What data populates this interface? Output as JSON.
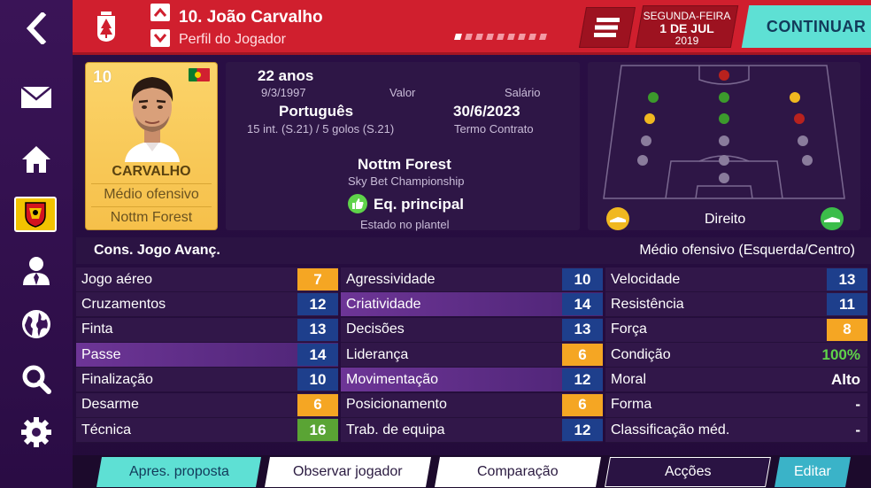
{
  "header": {
    "title": "10. João Carvalho",
    "subtitle": "Perfil do Jogador",
    "date_day": "SEGUNDA-FEIRA",
    "date_main": "1 DE JUL",
    "date_year": "2019",
    "continue_label": "CONTINUAR",
    "page_dots": 9,
    "active_dot": 0
  },
  "sidebar": {
    "items": [
      "back-arrow-icon",
      "mail-icon",
      "home-icon",
      "club-badge",
      "person-icon",
      "globe-icon",
      "search-icon",
      "settings-icon"
    ]
  },
  "player_card": {
    "number": "10",
    "name": "CARVALHO",
    "position": "Médio ofensivo",
    "club": "Nottm Forest",
    "nationality_flag": "portugal-flag"
  },
  "info": {
    "age": "22 anos",
    "dob": "9/3/1997",
    "value_label": "Valor",
    "salary_label": "Salário",
    "nationality": "Português",
    "caps": "15 int. (S.21) / 5 golos (S.21)",
    "contract_end": "30/6/2023",
    "contract_label": "Termo Contrato",
    "club": "Nottm Forest",
    "league": "Sky Bet Championship",
    "squad_status": "Eq. principal",
    "squad_status_label": "Estado no plantel"
  },
  "pitch": {
    "foot_label": "Direito"
  },
  "attributes": {
    "role": "Cons. Jogo Avanç.",
    "position_detail": "Médio ofensivo (Esquerda/Centro)",
    "col1": [
      {
        "label": "Jogo aéreo",
        "value": "7",
        "style": "orange"
      },
      {
        "label": "Cruzamentos",
        "value": "12",
        "style": "blue"
      },
      {
        "label": "Finta",
        "value": "13",
        "style": "blue"
      },
      {
        "label": "Passe",
        "value": "14",
        "style": "blue",
        "highlight": true
      },
      {
        "label": "Finalização",
        "value": "10",
        "style": "blue"
      },
      {
        "label": "Desarme",
        "value": "6",
        "style": "orange"
      },
      {
        "label": "Técnica",
        "value": "16",
        "style": "green"
      }
    ],
    "col2": [
      {
        "label": "Agressividade",
        "value": "10",
        "style": "blue"
      },
      {
        "label": "Criatividade",
        "value": "14",
        "style": "blue",
        "highlight": true
      },
      {
        "label": "Decisões",
        "value": "13",
        "style": "blue"
      },
      {
        "label": "Liderança",
        "value": "6",
        "style": "orange"
      },
      {
        "label": "Movimentação",
        "value": "12",
        "style": "blue",
        "highlight": true
      },
      {
        "label": "Posicionamento",
        "value": "6",
        "style": "orange"
      },
      {
        "label": "Trab. de equipa",
        "value": "12",
        "style": "blue"
      }
    ],
    "col3": [
      {
        "label": "Velocidade",
        "value": "13",
        "style": "blue"
      },
      {
        "label": "Resistência",
        "value": "11",
        "style": "blue"
      },
      {
        "label": "Força",
        "value": "8",
        "style": "orange"
      },
      {
        "label": "Condição",
        "value": "100%",
        "style": "good"
      },
      {
        "label": "Moral",
        "value": "Alto",
        "style": "text"
      },
      {
        "label": "Forma",
        "value": "-",
        "style": "text"
      },
      {
        "label": "Classificação méd.",
        "value": "-",
        "style": "text"
      }
    ]
  },
  "actions": {
    "offer": "Apres. proposta",
    "scout": "Observar jogador",
    "compare": "Comparação",
    "actions": "Acções",
    "edit": "Editar"
  },
  "colors": {
    "header_red": "#d01f2e",
    "accent_teal": "#5ee0d4",
    "card_gold": "#f6c04a",
    "attr_blue": "#1e3f8c",
    "attr_orange": "#f5a623",
    "attr_green": "#5aa434"
  }
}
